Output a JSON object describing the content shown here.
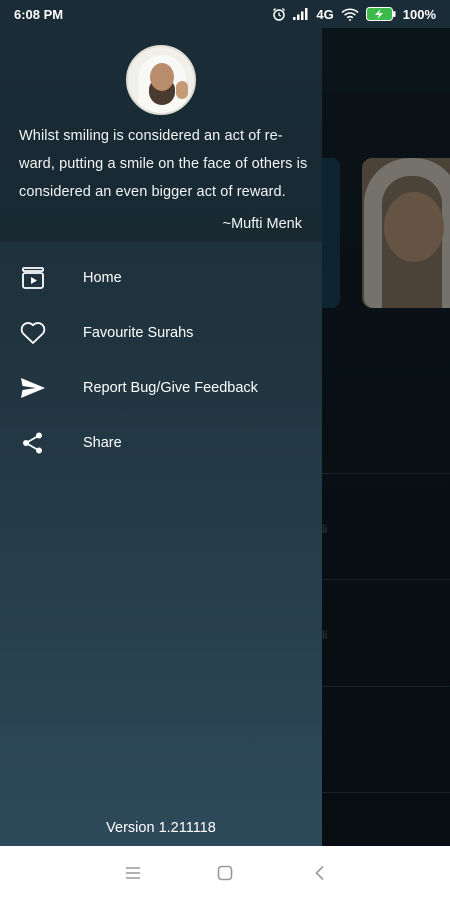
{
  "status_bar": {
    "time": "6:08 PM",
    "network": "4G",
    "battery": "100%"
  },
  "drawer": {
    "quote": "Whilst smiling is considered an act of re-ward, putting a smile on the face of others is considered an even bigger act of reward.",
    "author": "~Mufti Menk",
    "menu_items": [
      {
        "label": "Home",
        "icon": "play-folder-icon"
      },
      {
        "label": "Favourite Surahs",
        "icon": "heart-icon"
      },
      {
        "label": "Report Bug/Give Feedback",
        "icon": "send-icon"
      },
      {
        "label": "Share",
        "icon": "share-icon"
      }
    ],
    "version": "Version 1.211118"
  },
  "background": {
    "list_glyph_1": "li",
    "list_glyph_2": "li"
  },
  "colors": {
    "drawer_top": "#1a2c37",
    "drawer_bottom": "#2e4a5a",
    "text": "#ffffff"
  }
}
